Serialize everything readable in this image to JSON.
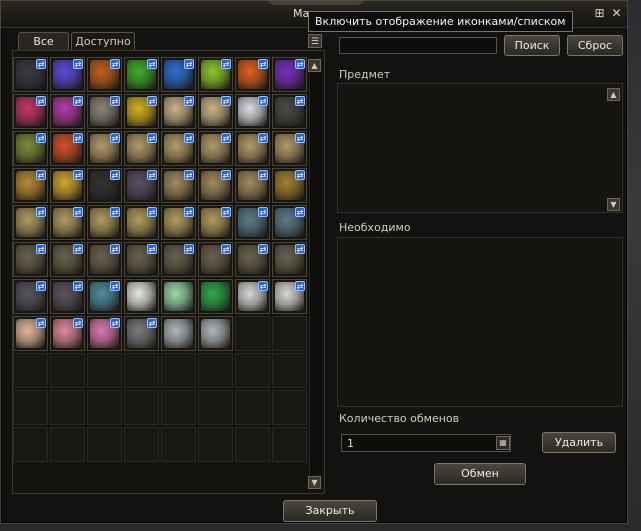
{
  "window": {
    "title": "Ма",
    "tooltip": "Включить отображение иконками/списком",
    "close_label": "Закрыть"
  },
  "tabs": [
    {
      "label": "Все",
      "active": true
    },
    {
      "label": "Доступно",
      "active": false
    }
  ],
  "search": {
    "value": "",
    "search_label": "Поиск",
    "reset_label": "Сброс"
  },
  "sections": {
    "item_label": "Предмет",
    "required_label": "Необходимо",
    "exchange_count_label": "Количество обменов"
  },
  "exchange": {
    "quantity": "1",
    "delete_label": "Удалить",
    "exchange_label": "Обмен"
  },
  "grid": {
    "columns": 8,
    "rows": 12,
    "items": [
      {
        "name": "black-dye-item",
        "color": "#3b3b45",
        "badge": true
      },
      {
        "name": "blue-purple-dye-item",
        "color": "#5b4bd8",
        "badge": true
      },
      {
        "name": "orange-dye-item",
        "color": "#c2611f",
        "badge": true
      },
      {
        "name": "green-dye-item",
        "color": "#3fae2e",
        "badge": true
      },
      {
        "name": "blue-dye-item",
        "color": "#2f6fd1",
        "badge": true
      },
      {
        "name": "lime-dye-item",
        "color": "#8ec52c",
        "badge": true
      },
      {
        "name": "orange-red-dye-item",
        "color": "#e0601e",
        "badge": true
      },
      {
        "name": "violet-dye-item",
        "color": "#7a2fc2",
        "badge": true
      },
      {
        "name": "pink-dye-item",
        "color": "#c2376a",
        "badge": true
      },
      {
        "name": "magenta-dye-item",
        "color": "#b63aa8",
        "badge": true
      },
      {
        "name": "grey-dye-item",
        "color": "#8a8578",
        "badge": true
      },
      {
        "name": "yellow-dye-item",
        "color": "#d2b21f",
        "badge": true
      },
      {
        "name": "scroll-item",
        "color": "#c8b48a",
        "badge": true
      },
      {
        "name": "scroll-item",
        "color": "#c8b48a",
        "badge": true
      },
      {
        "name": "crystal-item",
        "color": "#d8dde4",
        "badge": true
      },
      {
        "name": "ore-item",
        "color": "#4a4a48",
        "badge": true
      },
      {
        "name": "wreath-item",
        "color": "#7e8a3e",
        "badge": true
      },
      {
        "name": "potion-item",
        "color": "#d2502a",
        "badge": true
      },
      {
        "name": "book-item",
        "color": "#b29a6a",
        "badge": true
      },
      {
        "name": "book-item",
        "color": "#b29a6a",
        "badge": true
      },
      {
        "name": "book-item",
        "color": "#b29a6a",
        "badge": true
      },
      {
        "name": "book-item",
        "color": "#b29a6a",
        "badge": true
      },
      {
        "name": "book-item",
        "color": "#b29a6a",
        "badge": true
      },
      {
        "name": "book-item",
        "color": "#b29a6a",
        "badge": true
      },
      {
        "name": "dagger-item",
        "color": "#b88a35",
        "badge": true
      },
      {
        "name": "golden-cup-item",
        "color": "#d2a530",
        "badge": true
      },
      {
        "name": "coal-item",
        "color": "#333331",
        "badge": true
      },
      {
        "name": "stone-item",
        "color": "#5a4f6b",
        "badge": true
      },
      {
        "name": "scroll-bundle-item",
        "color": "#a08a60",
        "badge": true
      },
      {
        "name": "scroll-bundle-item",
        "color": "#a08a60",
        "badge": true
      },
      {
        "name": "scroll-bundle-item",
        "color": "#a08a60",
        "badge": true
      },
      {
        "name": "staff-item",
        "color": "#a3802f",
        "badge": true
      },
      {
        "name": "scroll-bundle-item",
        "color": "#b09a60",
        "badge": true
      },
      {
        "name": "scroll-bundle-item",
        "color": "#b09a60",
        "badge": true
      },
      {
        "name": "scroll-bundle-item",
        "color": "#b09a60",
        "badge": true
      },
      {
        "name": "scroll-bundle-item",
        "color": "#b09a60",
        "badge": true
      },
      {
        "name": "scroll-bundle-item",
        "color": "#b09a60",
        "badge": true
      },
      {
        "name": "scroll-bundle-item",
        "color": "#b09a60",
        "badge": true
      },
      {
        "name": "blueprint-item",
        "color": "#5d7b8a",
        "badge": true
      },
      {
        "name": "blueprint-item",
        "color": "#5d7b8a",
        "badge": true
      },
      {
        "name": "blueprint-item",
        "color": "#6a6250",
        "badge": true
      },
      {
        "name": "blueprint-item",
        "color": "#6a6250",
        "badge": true
      },
      {
        "name": "blueprint-item",
        "color": "#6a6250",
        "badge": true
      },
      {
        "name": "blueprint-item",
        "color": "#6a6250",
        "badge": true
      },
      {
        "name": "blueprint-item",
        "color": "#6a6250",
        "badge": true
      },
      {
        "name": "blueprint-item",
        "color": "#6a6250",
        "badge": true
      },
      {
        "name": "blueprint-item",
        "color": "#6a6250",
        "badge": true
      },
      {
        "name": "blueprint-item",
        "color": "#6a6250",
        "badge": true
      },
      {
        "name": "blueprint-item",
        "color": "#5a5560",
        "badge": true
      },
      {
        "name": "blueprint-item",
        "color": "#5a5560",
        "badge": true
      },
      {
        "name": "crystal-shard-item",
        "color": "#4c8ea0",
        "badge": true
      },
      {
        "name": "white-pearl-item",
        "color": "#e6e8e2",
        "badge": false
      },
      {
        "name": "green-pearl-item",
        "color": "#9ad8a8",
        "badge": false
      },
      {
        "name": "green-orb-item",
        "color": "#2fa84a",
        "badge": false
      },
      {
        "name": "rune-stone-item",
        "color": "#d8d8d8",
        "badge": true
      },
      {
        "name": "rune-stone-item",
        "color": "#d8d8d8",
        "badge": true
      },
      {
        "name": "rune-stone-item",
        "color": "#e2b89a",
        "badge": true
      },
      {
        "name": "rune-stone-item",
        "color": "#e08a9a",
        "badge": true
      },
      {
        "name": "rune-stone-item",
        "color": "#d87ab0",
        "badge": true
      },
      {
        "name": "rune-stone-item",
        "color": "#7a7a80",
        "badge": true
      },
      {
        "name": "fish-item",
        "color": "#aeb6bc",
        "badge": false
      },
      {
        "name": "fish-item",
        "color": "#aeb6bc",
        "badge": false
      }
    ]
  }
}
